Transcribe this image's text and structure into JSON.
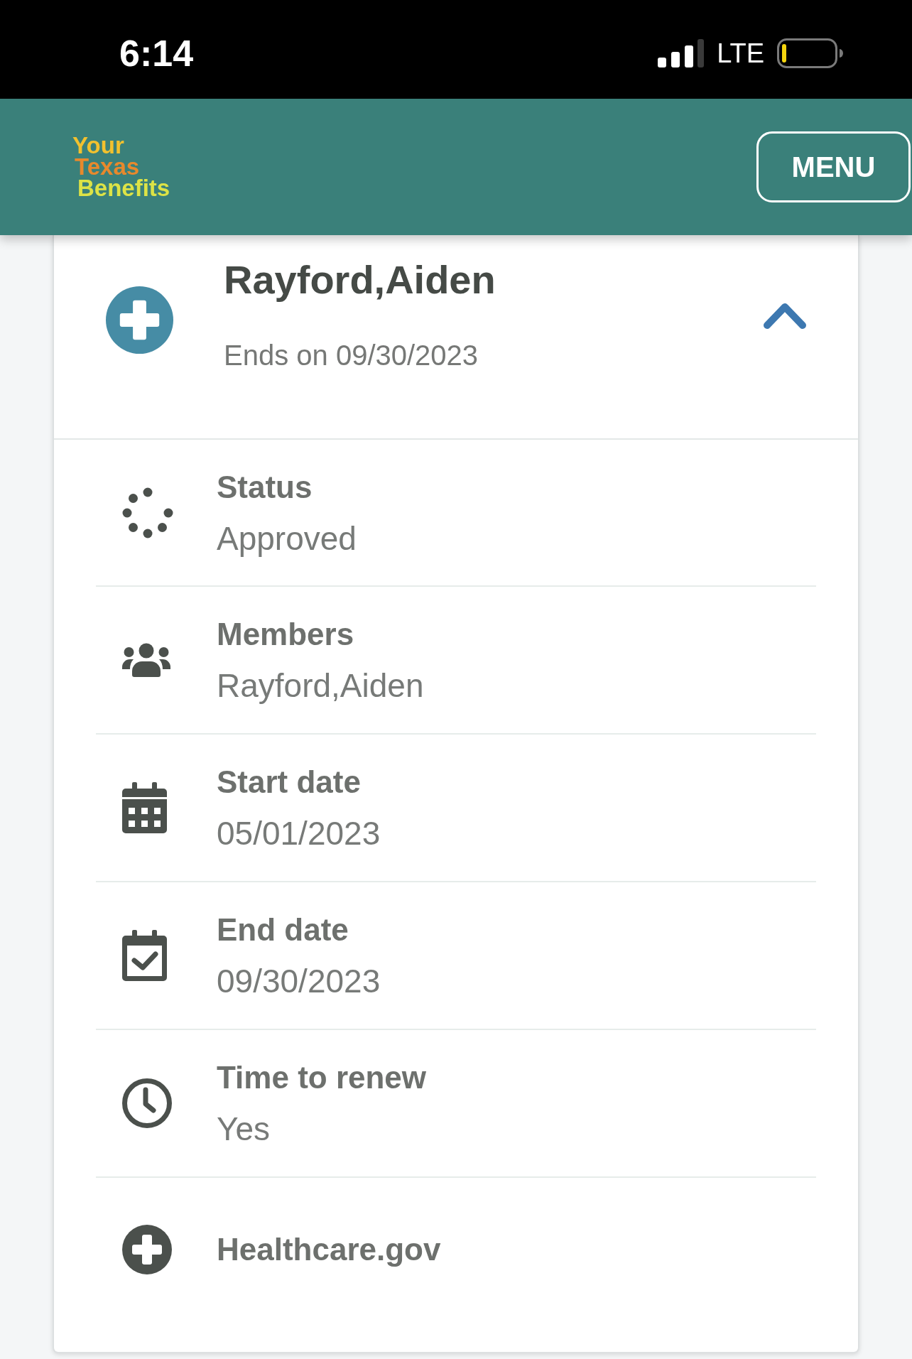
{
  "status_bar": {
    "time": "6:14",
    "network": "LTE"
  },
  "header": {
    "logo": [
      "Your",
      "Texas",
      "Benefits"
    ],
    "menu_button": "MENU"
  },
  "benefit": {
    "name": "Rayford,Aiden",
    "ends": "Ends on 09/30/2023",
    "expanded": true,
    "details": [
      {
        "kind": "status",
        "label": "Status",
        "value": "Approved"
      },
      {
        "kind": "members",
        "label": "Members",
        "value": "Rayford,Aiden"
      },
      {
        "kind": "start_date",
        "label": "Start date",
        "value": "05/01/2023"
      },
      {
        "kind": "end_date",
        "label": "End date",
        "value": "09/30/2023"
      },
      {
        "kind": "renewal",
        "label": "Time to renew",
        "value": "Yes"
      },
      {
        "kind": "link",
        "label": "Healthcare.gov"
      }
    ]
  }
}
